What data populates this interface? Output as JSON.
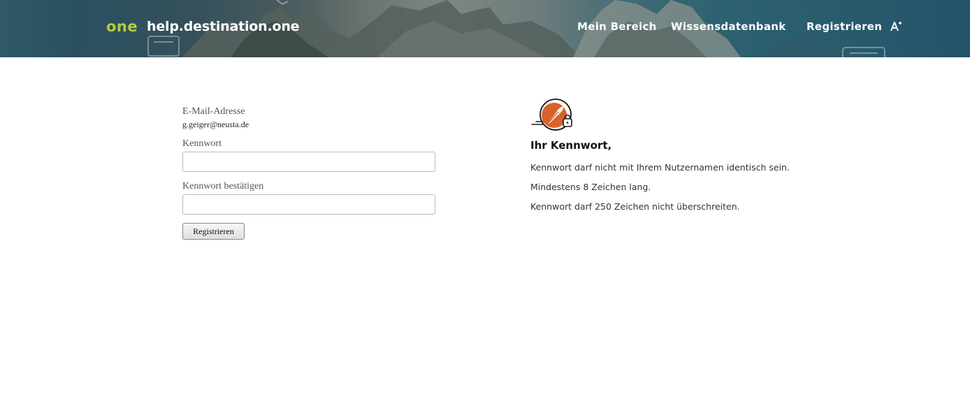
{
  "header": {
    "logo_text": "one",
    "site_title": "help.destination.one",
    "nav": {
      "mein_bereich": "Mein Bereich",
      "wissensdatenbank": "Wissensdatenbank",
      "registrieren": "Registrieren"
    },
    "accessibility_icon": "font-size-icon"
  },
  "form": {
    "email_label": "E-Mail-Adresse",
    "email_value": "g.geiger@neusta.de",
    "password_label": "Kennwort",
    "password_value": "",
    "password_confirm_label": "Kennwort bestätigen",
    "password_confirm_value": "",
    "submit_label": "Registrieren"
  },
  "info": {
    "icon": "password-lock-icon",
    "heading": "Ihr Kennwort,",
    "rules": [
      "Kennwort darf nicht mit Ihrem Nutzernamen identisch sein.",
      "Mindestens 8 Zeichen lang.",
      "Kennwort darf 250 Zeichen nicht überschreiten."
    ]
  },
  "colors": {
    "logo_accent": "#b5cc3a",
    "header_teal": "#2a5a6a",
    "icon_orange": "#d8622a"
  }
}
